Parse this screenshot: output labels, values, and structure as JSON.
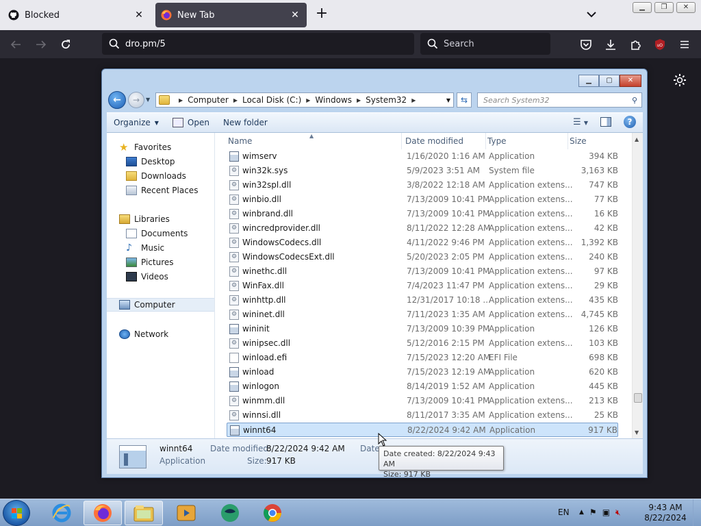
{
  "browser": {
    "tabs": [
      {
        "label": "Blocked",
        "icon": "github-icon"
      },
      {
        "label": "New Tab",
        "icon": "firefox-icon"
      }
    ],
    "url": "dro.pm/5",
    "search_placeholder": "Search"
  },
  "explorer": {
    "breadcrumbs": [
      "Computer",
      "Local Disk (C:)",
      "Windows",
      "System32"
    ],
    "search_placeholder": "Search System32",
    "toolbar": {
      "organize": "Organize",
      "open": "Open",
      "new_folder": "New folder"
    },
    "nav": {
      "favorites": "Favorites",
      "desktop": "Desktop",
      "downloads": "Downloads",
      "recent": "Recent Places",
      "libraries": "Libraries",
      "documents": "Documents",
      "music": "Music",
      "pictures": "Pictures",
      "videos": "Videos",
      "computer": "Computer",
      "network": "Network"
    },
    "columns": {
      "name": "Name",
      "date": "Date modified",
      "type": "Type",
      "size": "Size"
    },
    "files": [
      {
        "name": "wimserv",
        "date": "1/16/2020 1:16 AM",
        "type": "Application",
        "size": "394 KB",
        "kind": "app"
      },
      {
        "name": "win32k.sys",
        "date": "5/9/2023 3:51 AM",
        "type": "System file",
        "size": "3,163 KB",
        "kind": "dll"
      },
      {
        "name": "win32spl.dll",
        "date": "3/8/2022 12:18 AM",
        "type": "Application extens...",
        "size": "747 KB",
        "kind": "dll"
      },
      {
        "name": "winbio.dll",
        "date": "7/13/2009 10:41 PM",
        "type": "Application extens...",
        "size": "77 KB",
        "kind": "dll"
      },
      {
        "name": "winbrand.dll",
        "date": "7/13/2009 10:41 PM",
        "type": "Application extens...",
        "size": "16 KB",
        "kind": "dll"
      },
      {
        "name": "wincredprovider.dll",
        "date": "8/11/2022 12:28 AM",
        "type": "Application extens...",
        "size": "42 KB",
        "kind": "dll"
      },
      {
        "name": "WindowsCodecs.dll",
        "date": "4/11/2022 9:46 PM",
        "type": "Application extens...",
        "size": "1,392 KB",
        "kind": "dll"
      },
      {
        "name": "WindowsCodecsExt.dll",
        "date": "5/20/2023 2:05 PM",
        "type": "Application extens...",
        "size": "240 KB",
        "kind": "dll"
      },
      {
        "name": "winethc.dll",
        "date": "7/13/2009 10:41 PM",
        "type": "Application extens...",
        "size": "97 KB",
        "kind": "dll"
      },
      {
        "name": "WinFax.dll",
        "date": "7/4/2023 11:47 PM",
        "type": "Application extens...",
        "size": "29 KB",
        "kind": "dll"
      },
      {
        "name": "winhttp.dll",
        "date": "12/31/2017 10:18 ...",
        "type": "Application extens...",
        "size": "435 KB",
        "kind": "dll"
      },
      {
        "name": "wininet.dll",
        "date": "7/11/2023 1:35 AM",
        "type": "Application extens...",
        "size": "4,745 KB",
        "kind": "dll"
      },
      {
        "name": "wininit",
        "date": "7/13/2009 10:39 PM",
        "type": "Application",
        "size": "126 KB",
        "kind": "app"
      },
      {
        "name": "winipsec.dll",
        "date": "5/12/2016 2:15 PM",
        "type": "Application extens...",
        "size": "103 KB",
        "kind": "dll"
      },
      {
        "name": "winload.efi",
        "date": "7/15/2023 12:20 AM",
        "type": "EFI File",
        "size": "698 KB",
        "kind": "blank"
      },
      {
        "name": "winload",
        "date": "7/15/2023 12:19 AM",
        "type": "Application",
        "size": "620 KB",
        "kind": "app"
      },
      {
        "name": "winlogon",
        "date": "8/14/2019 1:52 AM",
        "type": "Application",
        "size": "445 KB",
        "kind": "app"
      },
      {
        "name": "winmm.dll",
        "date": "7/13/2009 10:41 PM",
        "type": "Application extens...",
        "size": "213 KB",
        "kind": "dll"
      },
      {
        "name": "winnsi.dll",
        "date": "8/11/2017 3:35 AM",
        "type": "Application extens...",
        "size": "25 KB",
        "kind": "dll"
      },
      {
        "name": "winnt64",
        "date": "8/22/2024 9:42 AM",
        "type": "Application",
        "size": "917 KB",
        "kind": "app"
      }
    ],
    "details": {
      "name": "winnt64",
      "type": "Application",
      "modified_label": "Date modified:",
      "modified_value": "8/22/2024 9:42 AM",
      "size_label": "Size:",
      "size_value": "917 KB",
      "created_label": "Date c"
    },
    "tooltip": {
      "line1": "Date created: 8/22/2024 9:43 AM",
      "line2": "Size: 917 KB"
    }
  },
  "taskbar": {
    "lang": "EN",
    "time": "9:43 AM",
    "date": "8/22/2024"
  }
}
